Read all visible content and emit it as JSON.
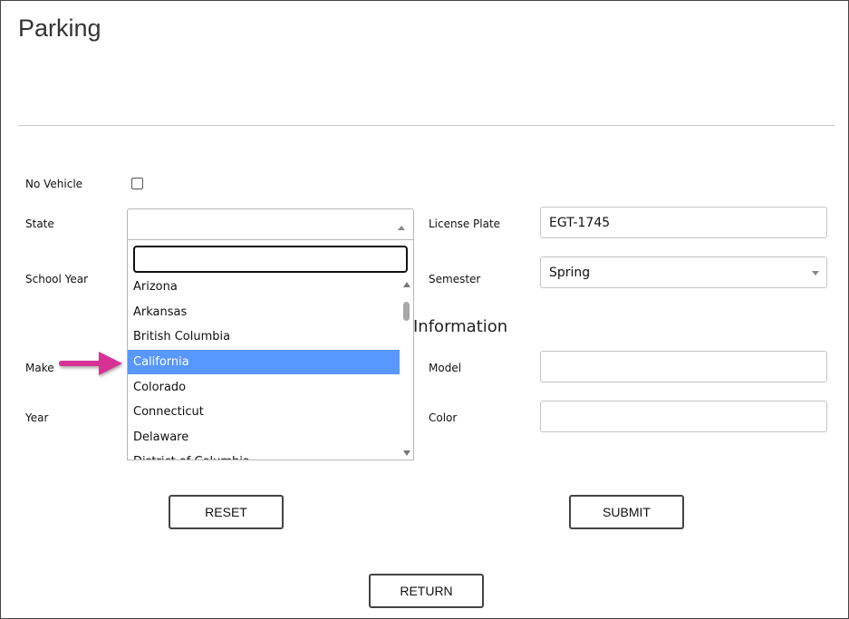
{
  "page": {
    "title": "Parking"
  },
  "form": {
    "no_vehicle_label": "No Vehicle",
    "no_vehicle_checked": false,
    "state_label": "State",
    "state_value": "",
    "license_plate_label": "License Plate",
    "license_plate_value": "EGT-1745",
    "school_year_label": "School Year",
    "semester_label": "Semester",
    "semester_value": "Spring",
    "vehicle_section_heading_visible": "Information",
    "make_label": "Make",
    "model_label": "Model",
    "model_value": "",
    "year_label": "Year",
    "color_label": "Color",
    "color_value": ""
  },
  "state_dropdown": {
    "search_value": "",
    "options": [
      {
        "label": "Arizona",
        "selected": false
      },
      {
        "label": "Arkansas",
        "selected": false
      },
      {
        "label": "British Columbia",
        "selected": false
      },
      {
        "label": "California",
        "selected": true
      },
      {
        "label": "Colorado",
        "selected": false
      },
      {
        "label": "Connecticut",
        "selected": false
      },
      {
        "label": "Delaware",
        "selected": false
      },
      {
        "label": "District of Columbia",
        "selected": false
      }
    ]
  },
  "buttons": {
    "reset_label": "RESET",
    "submit_label": "SUBMIT",
    "return_label": "RETURN"
  },
  "colors": {
    "highlight": "#5897fb",
    "annotation_arrow": "#d63196",
    "border": "#c4c4c4"
  }
}
